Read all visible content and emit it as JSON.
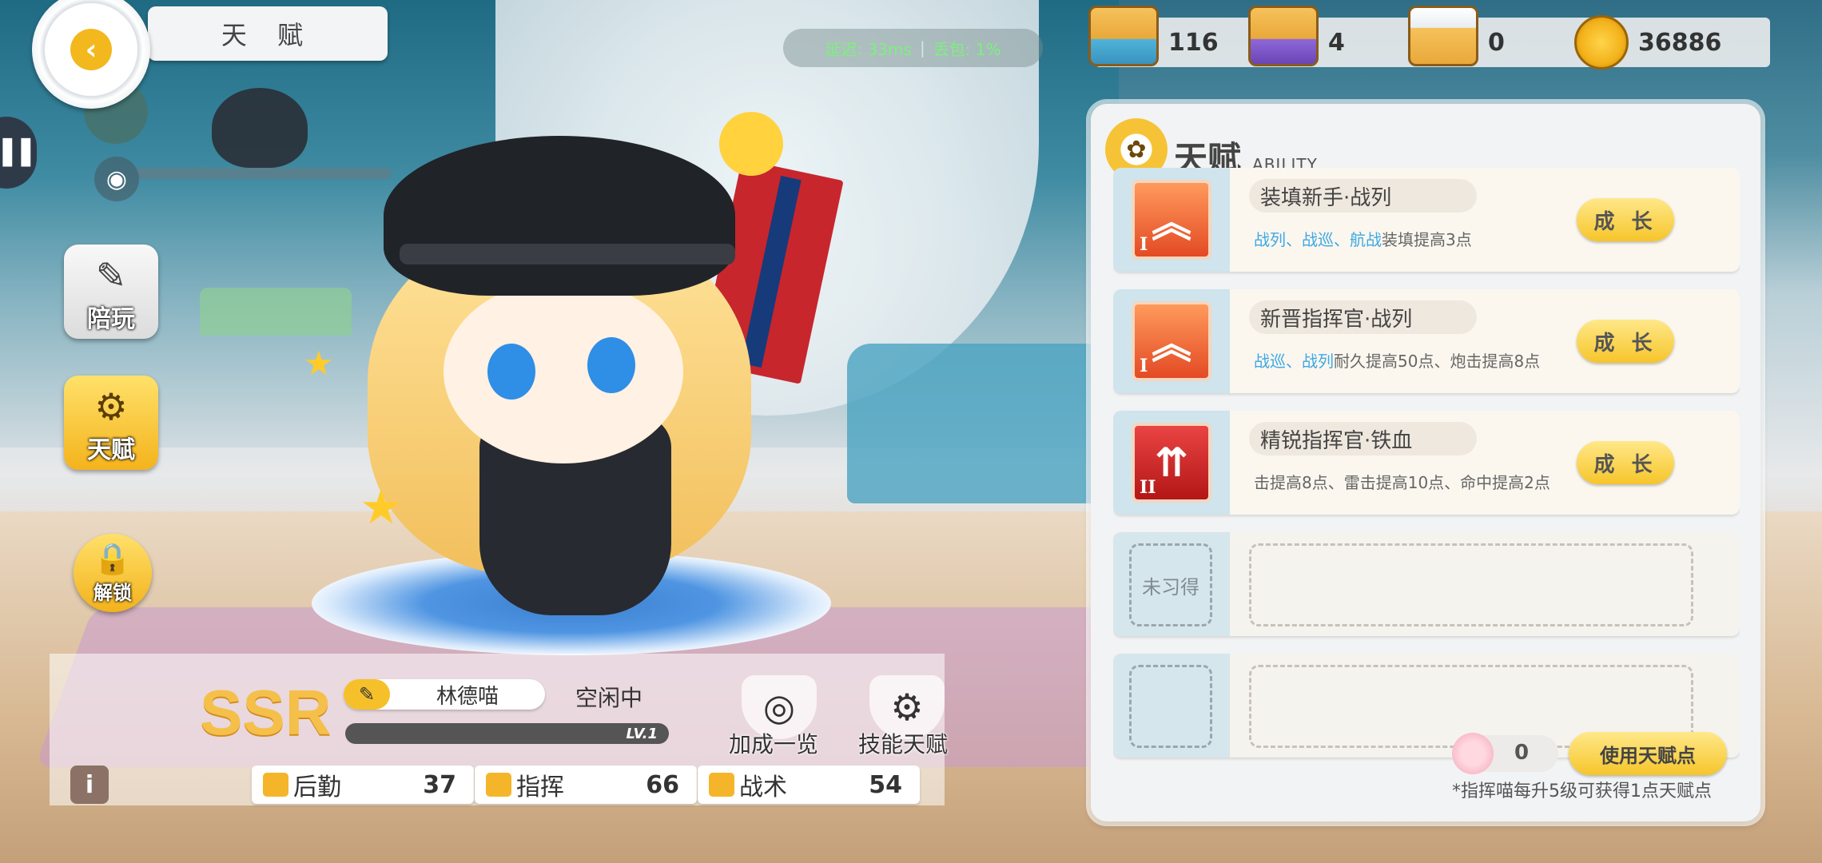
{
  "header": {
    "title": "天 赋",
    "back_icon": "back-arrow-icon"
  },
  "ping": {
    "latency": "延迟: 33ms",
    "loss": "丢包: 1%"
  },
  "currencies": [
    {
      "icon": "blue-box-icon",
      "value": "116"
    },
    {
      "icon": "purple-box-icon",
      "value": "4"
    },
    {
      "icon": "hat-box-icon",
      "value": "0"
    },
    {
      "icon": "coin-icon",
      "value": "36886"
    }
  ],
  "sidebar": {
    "eye_icon": "eye-icon",
    "play_label": "陪玩",
    "talent_label": "天赋",
    "unlock_label": "解锁"
  },
  "character": {
    "rarity": "SSR",
    "name": "林德喵",
    "status": "空闲中",
    "level": "LV.1"
  },
  "actions": {
    "bonus_label": "加成一览",
    "skill_label": "技能天赋"
  },
  "stats": [
    {
      "label": "后勤",
      "value": "37"
    },
    {
      "label": "指挥",
      "value": "66"
    },
    {
      "label": "战术",
      "value": "54"
    }
  ],
  "talent_panel": {
    "title": "天赋",
    "subtitle": "ABILITY",
    "items": [
      {
        "name": "装填新手·战列",
        "tier": "I",
        "desc_hl": "战列、战巡、航战",
        "desc": "装填提高3点",
        "button": "成 长"
      },
      {
        "name": "新晋指挥官·战列",
        "tier": "I",
        "desc_hl": "战巡、战列",
        "desc": "耐久提高50点、炮击提高8点",
        "button": "成 长"
      },
      {
        "name": "精锐指挥官·铁血",
        "tier": "II",
        "desc_hl": "",
        "desc": "击提高8点、雷击提高10点、命中提高2点",
        "button": "成 长"
      }
    ],
    "locked_label": "未习得",
    "points_value": "0",
    "use_button": "使用天赋点",
    "note": "*指挥喵每升5级可获得1点天赋点"
  },
  "colors": {
    "accent_yellow": "#f6c52a",
    "highlight_blue": "#3da8e4",
    "rarity_gold": "#f5c04a"
  }
}
